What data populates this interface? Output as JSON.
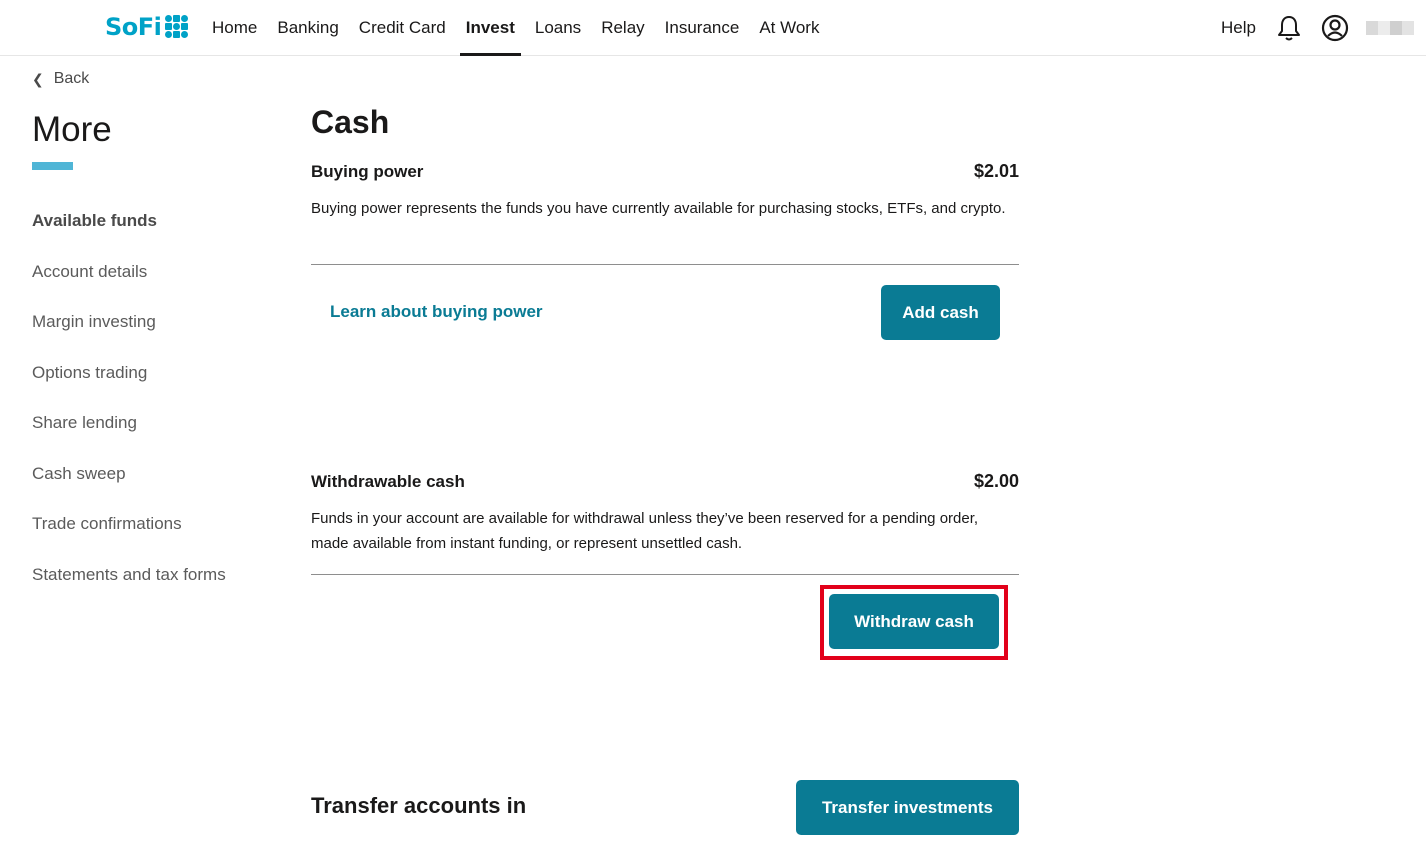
{
  "brand": {
    "name": "SoFi",
    "accent": "#00a2c7",
    "button_color": "#0a7b94",
    "highlight_color": "#e2001a"
  },
  "nav": {
    "items": [
      {
        "label": "Home",
        "active": false
      },
      {
        "label": "Banking",
        "active": false
      },
      {
        "label": "Credit Card",
        "active": false
      },
      {
        "label": "Invest",
        "active": true
      },
      {
        "label": "Loans",
        "active": false
      },
      {
        "label": "Relay",
        "active": false
      },
      {
        "label": "Insurance",
        "active": false
      },
      {
        "label": "At Work",
        "active": false
      }
    ],
    "help_label": "Help",
    "icons": [
      "bell-icon",
      "account-icon"
    ]
  },
  "sidebar": {
    "back_label": "Back",
    "title": "More",
    "items": [
      {
        "label": "Available funds",
        "active": true
      },
      {
        "label": "Account details",
        "active": false
      },
      {
        "label": "Margin investing",
        "active": false
      },
      {
        "label": "Options trading",
        "active": false
      },
      {
        "label": "Share lending",
        "active": false
      },
      {
        "label": "Cash sweep",
        "active": false
      },
      {
        "label": "Trade confirmations",
        "active": false
      },
      {
        "label": "Statements and tax forms",
        "active": false
      }
    ]
  },
  "main": {
    "title": "Cash",
    "buying_power": {
      "label": "Buying power",
      "value": "$2.01",
      "description": "Buying power represents the funds you have currently available for purchasing stocks, ETFs, and crypto.",
      "link_label": "Learn about buying power",
      "button_label": "Add cash"
    },
    "withdrawable": {
      "label": "Withdrawable cash",
      "value": "$2.00",
      "description": "Funds in your account are available for withdrawal unless they’ve been reserved for a pending order, made available from instant funding, or represent unsettled cash.",
      "button_label": "Withdraw cash"
    },
    "transfer": {
      "label": "Transfer accounts in",
      "button_label": "Transfer investments"
    }
  }
}
